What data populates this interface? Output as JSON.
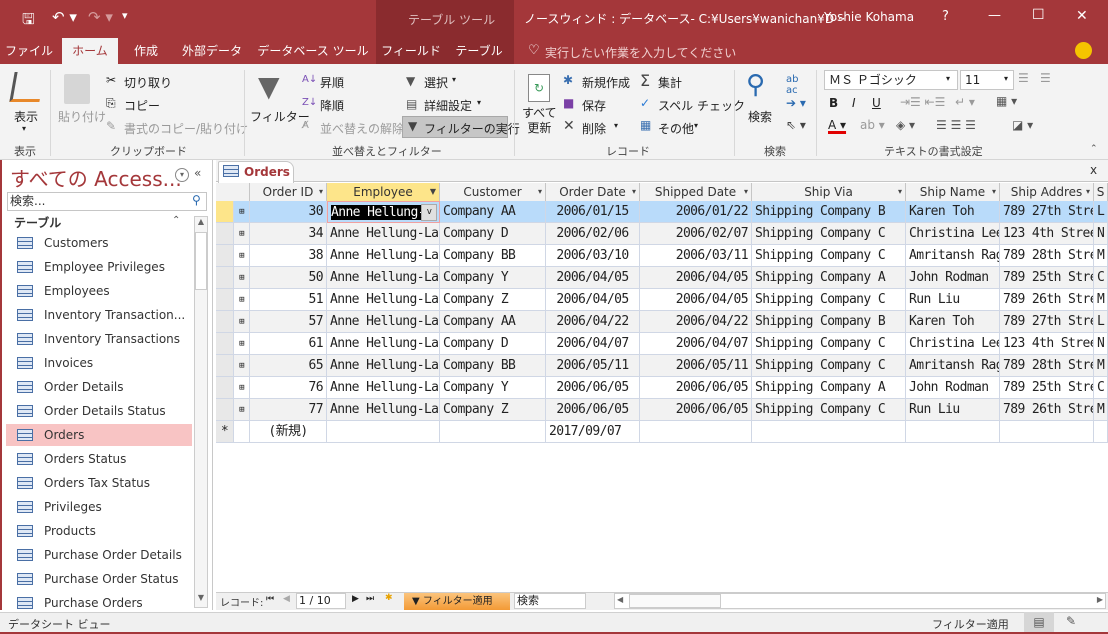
{
  "titlebar": {
    "context_tab": "テーブル ツール",
    "title": "ノースウィンド : データベース- C:¥Users¥wanichan¥D···",
    "user": "Yoshie Kohama",
    "help": "?",
    "minimize": "—",
    "maximize": "☐",
    "close": "✕"
  },
  "tabs": [
    "ファイル",
    "ホーム",
    "作成",
    "外部データ",
    "データベース ツール",
    "フィールド",
    "テーブル"
  ],
  "tell_me": "実行したい作業を入力してください",
  "ribbon": {
    "view": {
      "label": "表示",
      "group": "表示"
    },
    "clipboard": {
      "paste": "貼り付け",
      "cut": "切り取り",
      "copy": "コピー",
      "format_painter": "書式のコピー/貼り付け",
      "group": "クリップボード"
    },
    "sort_filter": {
      "filter": "フィルター",
      "asc": "昇順",
      "desc": "降順",
      "remove_sort": "並べ替えの解除",
      "selection": "選択",
      "advanced": "詳細設定",
      "toggle_filter": "フィルターの実行",
      "group": "並べ替えとフィルター"
    },
    "records": {
      "refresh": "すべて\n更新",
      "new": "新規作成",
      "save": "保存",
      "delete": "削除",
      "totals": "集計",
      "spelling": "スペル チェック",
      "more": "その他",
      "group": "レコード"
    },
    "find": {
      "find": "検索",
      "group": "検索"
    },
    "text_format": {
      "font": "ＭＳ Ｐゴシック",
      "size": "11",
      "bold": "B",
      "italic": "I",
      "underline": "U",
      "group": "テキストの書式設定"
    }
  },
  "nav": {
    "title": "すべての Access...",
    "search_placeholder": "検索...",
    "section": "テーブル",
    "items": [
      "Customers",
      "Employee Privileges",
      "Employees",
      "Inventory Transaction...",
      "Inventory Transactions",
      "Invoices",
      "Order Details",
      "Order Details Status",
      "Orders",
      "Orders Status",
      "Orders Tax Status",
      "Privileges",
      "Products",
      "Purchase Order Details",
      "Purchase Order Status",
      "Purchase Orders"
    ],
    "selected": "Orders"
  },
  "document": {
    "tab": "Orders",
    "close": "x",
    "columns": [
      "Order ID",
      "Employee",
      "Customer",
      "Order Date",
      "Shipped Date",
      "Ship Via",
      "Ship Name",
      "Ship Addres",
      "S"
    ],
    "rows": [
      [
        "30",
        "Anne Hellung-",
        "Company AA",
        "2006/01/15",
        "2006/01/22",
        "Shipping Company B",
        "Karen Toh",
        "789 27th Stre",
        "L"
      ],
      [
        "34",
        "Anne Hellung-La",
        "Company D",
        "2006/02/06",
        "2006/02/07",
        "Shipping Company C",
        "Christina Lee",
        "123 4th Stree",
        "N"
      ],
      [
        "38",
        "Anne Hellung-La",
        "Company BB",
        "2006/03/10",
        "2006/03/11",
        "Shipping Company C",
        "Amritansh Rag",
        "789 28th Stre",
        "M"
      ],
      [
        "50",
        "Anne Hellung-La",
        "Company Y",
        "2006/04/05",
        "2006/04/05",
        "Shipping Company A",
        "John Rodman",
        "789 25th Stre",
        "C"
      ],
      [
        "51",
        "Anne Hellung-La",
        "Company Z",
        "2006/04/05",
        "2006/04/05",
        "Shipping Company C",
        "Run Liu",
        "789 26th Stre",
        "M"
      ],
      [
        "57",
        "Anne Hellung-La",
        "Company AA",
        "2006/04/22",
        "2006/04/22",
        "Shipping Company B",
        "Karen Toh",
        "789 27th Stre",
        "L"
      ],
      [
        "61",
        "Anne Hellung-La",
        "Company D",
        "2006/04/07",
        "2006/04/07",
        "Shipping Company C",
        "Christina Lee",
        "123 4th Stree",
        "N"
      ],
      [
        "65",
        "Anne Hellung-La",
        "Company BB",
        "2006/05/11",
        "2006/05/11",
        "Shipping Company C",
        "Amritansh Rag",
        "789 28th Stre",
        "M"
      ],
      [
        "76",
        "Anne Hellung-La",
        "Company Y",
        "2006/06/05",
        "2006/06/05",
        "Shipping Company A",
        "John Rodman",
        "789 25th Stre",
        "C"
      ],
      [
        "77",
        "Anne Hellung-La",
        "Company Z",
        "2006/06/05",
        "2006/06/05",
        "Shipping Company C",
        "Run Liu",
        "789 26th Stre",
        "M"
      ]
    ],
    "new_row": {
      "marker": "*",
      "id": "(新規)",
      "order_date": "2017/09/07"
    },
    "filtered_column": "Employee"
  },
  "record_nav": {
    "label": "レコード:",
    "position": "1 / 10",
    "filter_status": "フィルター適用",
    "search": "検索"
  },
  "statusbar": {
    "view": "データシート ビュー",
    "filter": "フィルター適用"
  },
  "colors": {
    "brand": "#a4373a",
    "selected_row": "#b9dbfa",
    "filter_header": "#fde58a",
    "filter_button": "#f7a94a"
  }
}
